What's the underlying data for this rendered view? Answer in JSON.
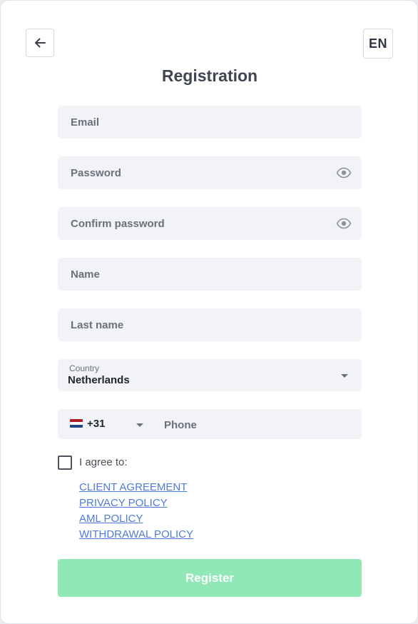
{
  "header": {
    "title": "Registration",
    "language": "EN",
    "back_icon": "arrow-left-icon"
  },
  "form": {
    "email_placeholder": "Email",
    "password_placeholder": "Password",
    "confirm_password_placeholder": "Confirm password",
    "name_placeholder": "Name",
    "last_name_placeholder": "Last name",
    "eye_icon": "eye-icon",
    "country": {
      "label": "Country",
      "value": "Netherlands"
    },
    "phone": {
      "flag": "netherlands-flag-icon",
      "code": "+31",
      "placeholder": "Phone"
    }
  },
  "agreement": {
    "label": "I agree to:",
    "checked": false,
    "links": [
      "CLIENT AGREEMENT",
      "PRIVACY POLICY",
      "AML POLICY",
      "WITHDRAWAL POLICY"
    ]
  },
  "actions": {
    "register_label": "Register"
  },
  "colors": {
    "field_background": "#f2f3f6",
    "register_button": "#90e8b7",
    "link": "#4e7bd8",
    "title": "#3f4652"
  }
}
